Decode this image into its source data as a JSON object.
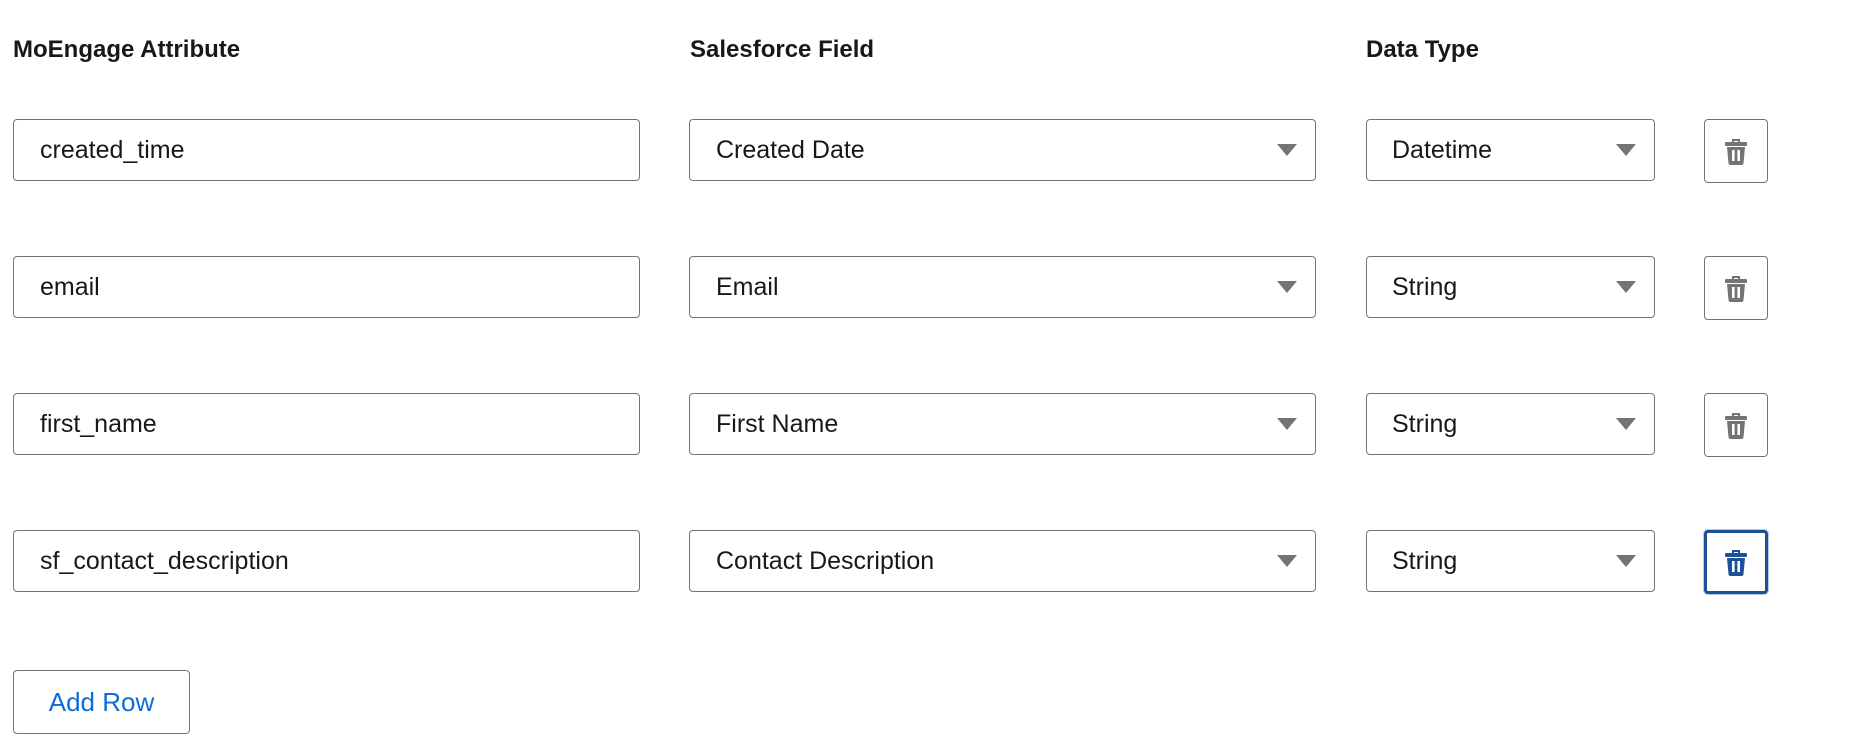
{
  "headers": {
    "moengage_attribute": "MoEngage Attribute",
    "salesforce_field": "Salesforce Field",
    "data_type": "Data Type"
  },
  "rows": [
    {
      "attribute": "created_time",
      "field": "Created Date",
      "type": "Datetime",
      "delete_icon": "trash-icon",
      "focused": false
    },
    {
      "attribute": "email",
      "field": "Email",
      "type": "String",
      "delete_icon": "trash-icon",
      "focused": false
    },
    {
      "attribute": "first_name",
      "field": "First Name",
      "type": "String",
      "delete_icon": "trash-icon",
      "focused": false
    },
    {
      "attribute": "sf_contact_description",
      "field": "Contact Description",
      "type": "String",
      "delete_icon": "trash-icon",
      "focused": true
    }
  ],
  "add_row_label": "Add Row",
  "colors": {
    "text": "#181818",
    "border": "#747474",
    "link_blue": "#0b6ed6",
    "focus_blue": "#1b5297"
  }
}
